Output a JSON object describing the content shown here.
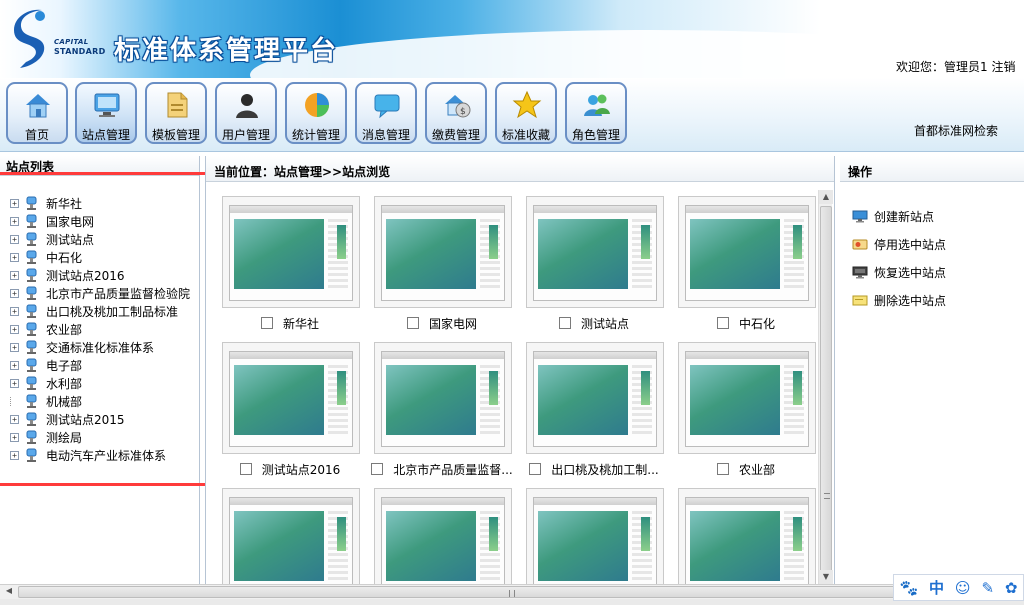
{
  "header": {
    "logo_caption_top": "CAPITAL",
    "logo_caption_bottom": "STANDARD",
    "app_title": "标准体系管理平台",
    "welcome": "欢迎您：管理员1 注销"
  },
  "toolbar": {
    "items": [
      {
        "label": "首页",
        "icon": "home-icon"
      },
      {
        "label": "站点管理",
        "icon": "monitor-icon"
      },
      {
        "label": "模板管理",
        "icon": "template-icon"
      },
      {
        "label": "用户管理",
        "icon": "user-icon"
      },
      {
        "label": "统计管理",
        "icon": "pie-chart-icon"
      },
      {
        "label": "消息管理",
        "icon": "message-icon"
      },
      {
        "label": "缴费管理",
        "icon": "payment-icon"
      },
      {
        "label": "标准收藏",
        "icon": "star-icon"
      },
      {
        "label": "角色管理",
        "icon": "role-icon"
      }
    ],
    "active_index": 1,
    "search_link": "首都标准网检索"
  },
  "left_panel": {
    "title": "站点列表",
    "tree": [
      {
        "label": "新华社",
        "expandable": true
      },
      {
        "label": "国家电网",
        "expandable": true
      },
      {
        "label": "测试站点",
        "expandable": true
      },
      {
        "label": "中石化",
        "expandable": true
      },
      {
        "label": "测试站点2016",
        "expandable": true
      },
      {
        "label": "北京市产品质量监督检验院",
        "expandable": true
      },
      {
        "label": "出口桃及桃加工制品标准",
        "expandable": true
      },
      {
        "label": "农业部",
        "expandable": true
      },
      {
        "label": "交通标准化标准体系",
        "expandable": true
      },
      {
        "label": "电子部",
        "expandable": true
      },
      {
        "label": "水利部",
        "expandable": true
      },
      {
        "label": "机械部",
        "expandable": false
      },
      {
        "label": "测试站点2015",
        "expandable": true
      },
      {
        "label": "测绘局",
        "expandable": true
      },
      {
        "label": "电动汽车产业标准体系",
        "expandable": true
      }
    ]
  },
  "center_panel": {
    "breadcrumb": "当前位置：站点管理>>站点浏览",
    "sites": [
      {
        "label": "新华社"
      },
      {
        "label": "国家电网"
      },
      {
        "label": "测试站点"
      },
      {
        "label": "中石化"
      },
      {
        "label": "测试站点2016"
      },
      {
        "label": "北京市产品质量监督..."
      },
      {
        "label": "出口桃及桃加工制..."
      },
      {
        "label": "农业部"
      },
      {
        "label": ""
      },
      {
        "label": ""
      },
      {
        "label": ""
      },
      {
        "label": ""
      }
    ]
  },
  "right_panel": {
    "title": "操作",
    "actions": [
      {
        "label": "创建新站点",
        "icon": "monitor-add-icon"
      },
      {
        "label": "停用选中站点",
        "icon": "disable-card-icon"
      },
      {
        "label": "恢复选中站点",
        "icon": "monitor-restore-icon"
      },
      {
        "label": "删除选中站点",
        "icon": "delete-note-icon"
      }
    ]
  },
  "ime_bar": {
    "mode": "中"
  },
  "colors": {
    "accent": "#1b8fd4",
    "highlight_box": "#ff3b3b",
    "toolbar_border": "#6a8fc5"
  }
}
